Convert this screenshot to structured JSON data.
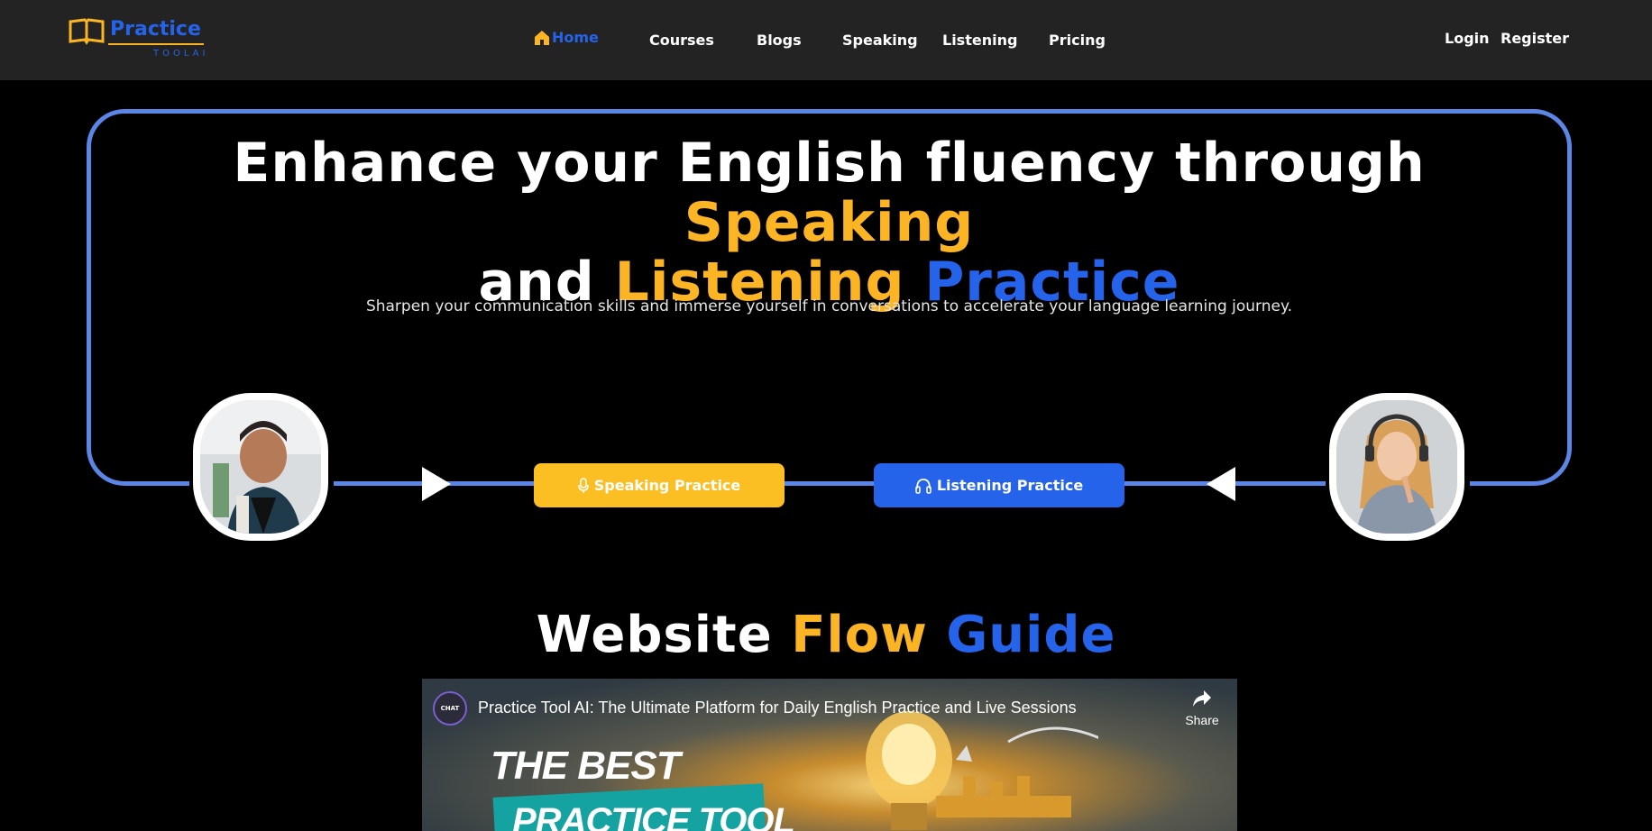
{
  "brand": {
    "name": "Practice",
    "sub": "TOOLAI",
    "color_primary": "#2563eb",
    "color_accent": "#fbb424"
  },
  "nav": {
    "items": [
      {
        "label": "Home",
        "icon": "home-icon",
        "active": true
      },
      {
        "label": "Courses"
      },
      {
        "label": "Blogs"
      },
      {
        "label": "Speaking"
      },
      {
        "label": "Listening"
      },
      {
        "label": "Pricing"
      }
    ],
    "login": "Login",
    "register": "Register"
  },
  "hero": {
    "title_part1": "Enhance your English fluency through ",
    "title_speaking": "Speaking",
    "title_and": "and ",
    "title_listening": "Listening",
    "title_practice": " Practice",
    "subtitle": "Sharpen your communication skills and immerse yourself in conversations to accelerate your language learning journey.",
    "speaking_button": "Speaking Practice",
    "listening_button": "Listening Practice"
  },
  "guide": {
    "title_website": "Website ",
    "title_flow": "Flow",
    "title_guide": " Guide"
  },
  "video": {
    "channel_badge": "CHAT",
    "title": "Practice Tool AI: The Ultimate Platform for Daily English Practice and Live Sessions",
    "share": "Share",
    "thumb_line1": "THE BEST",
    "thumb_line2": "PRACTICE TOOL"
  }
}
